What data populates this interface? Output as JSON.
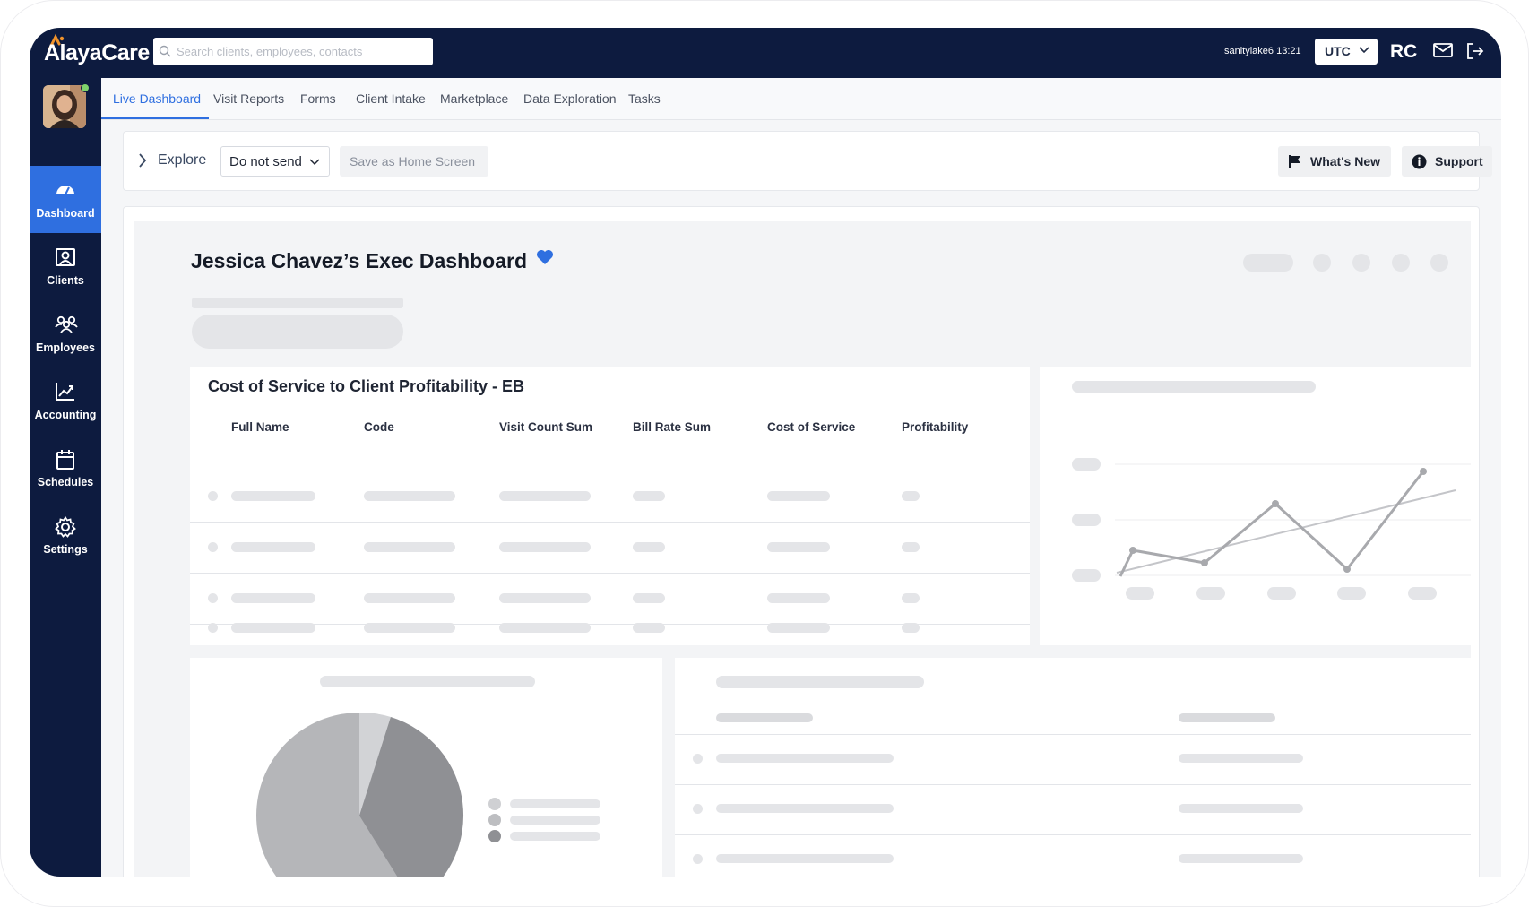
{
  "app": {
    "logo_text": "AlayaCare",
    "search_placeholder": "Search clients, employees, contacts",
    "user_label": "sanitylake6  13:21",
    "timezone": "UTC",
    "initials": "RC"
  },
  "sidebar": {
    "items": [
      {
        "label": "Dashboard",
        "icon": "dashboard-icon",
        "active": true
      },
      {
        "label": "Clients",
        "icon": "clients-icon"
      },
      {
        "label": "Employees",
        "icon": "employees-icon"
      },
      {
        "label": "Accounting",
        "icon": "accounting-icon"
      },
      {
        "label": "Schedules",
        "icon": "schedules-icon"
      },
      {
        "label": "Settings",
        "icon": "gear-icon"
      }
    ]
  },
  "tabs": [
    "Live Dashboard",
    "Visit Reports",
    "Forms",
    "Client Intake",
    "Marketplace",
    "Data Exploration",
    "Tasks"
  ],
  "toolbar": {
    "explore_label": "Explore",
    "send_value": "Do not send",
    "save_home_label": "Save as Home Screen",
    "whats_new_label": "What's New",
    "support_label": "Support"
  },
  "dashboard": {
    "title": "Jessica Chavez’s Exec Dashboard",
    "favorite_color": "#2f6fe0",
    "table": {
      "title": "Cost of Service to Client Profitability - EB",
      "columns": [
        "Full Name",
        "Code",
        "Visit Count Sum",
        "Bill Rate Sum",
        "Cost of Service",
        "Profitability"
      ]
    }
  },
  "colors": {
    "navy": "#0d1b3f",
    "accent": "#2f6fe0"
  }
}
